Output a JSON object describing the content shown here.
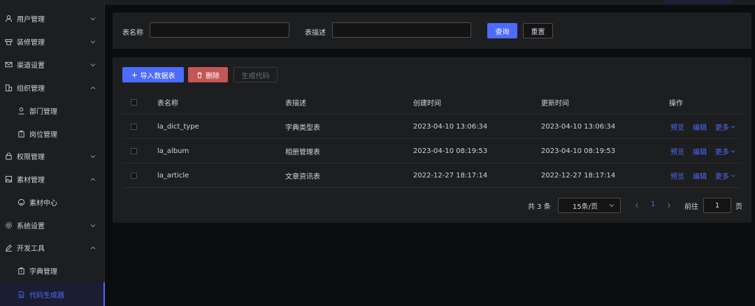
{
  "sidebar": {
    "items": [
      {
        "label": "用户管理",
        "icon": "user-icon",
        "arrow": "down"
      },
      {
        "label": "装修管理",
        "icon": "decoration-icon",
        "arrow": "down"
      },
      {
        "label": "渠道设置",
        "icon": "mail-icon",
        "arrow": "down"
      },
      {
        "label": "组织管理",
        "icon": "organization-icon",
        "arrow": "up"
      },
      {
        "label": "部门管理",
        "icon": "user-icon",
        "sub": true
      },
      {
        "label": "岗位管理",
        "icon": "briefcase-icon",
        "sub": true
      },
      {
        "label": "权限管理",
        "icon": "lock-icon",
        "arrow": "down"
      },
      {
        "label": "素材管理",
        "icon": "image-icon",
        "arrow": "up"
      },
      {
        "label": "素材中心",
        "icon": "smile-icon",
        "sub": true
      },
      {
        "label": "系统设置",
        "icon": "gear-icon",
        "arrow": "down"
      },
      {
        "label": "开发工具",
        "icon": "edit-icon",
        "arrow": "up"
      },
      {
        "label": "字典管理",
        "icon": "briefcase-icon",
        "sub": true
      },
      {
        "label": "代码生成器",
        "icon": "document-icon",
        "sub": true,
        "active": true
      }
    ]
  },
  "search": {
    "table_name_label": "表名称",
    "table_name_value": "",
    "table_desc_label": "表描述",
    "table_desc_value": "",
    "query_label": "查询",
    "reset_label": "重置"
  },
  "toolbar": {
    "import_label": "导入数据表",
    "delete_label": "删除",
    "generate_label": "生成代码"
  },
  "table": {
    "headers": {
      "name": "表名称",
      "desc": "表描述",
      "created": "创建时间",
      "updated": "更新时间",
      "actions": "操作"
    },
    "rows": [
      {
        "name": "la_dict_type",
        "desc": "字典类型表",
        "created": "2023-04-10 13:06:34",
        "updated": "2023-04-10 13:06:34"
      },
      {
        "name": "la_album",
        "desc": "相册管理表",
        "created": "2023-04-10 08:19:53",
        "updated": "2023-04-10 08:19:53"
      },
      {
        "name": "la_article",
        "desc": "文章资讯表",
        "created": "2022-12-27 18:17:14",
        "updated": "2022-12-27 18:17:14"
      }
    ],
    "actions": {
      "preview": "预览",
      "edit": "编辑",
      "more": "更多"
    }
  },
  "pagination": {
    "total_text": "共 3 条",
    "page_size": "15条/页",
    "current_page": "1",
    "goto_label": "前往",
    "goto_value": "1",
    "page_suffix": "页"
  },
  "colors": {
    "primary": "#4d6bfe",
    "danger": "#c45656",
    "background": "#0b0c0e",
    "card": "#1d1e1f"
  }
}
